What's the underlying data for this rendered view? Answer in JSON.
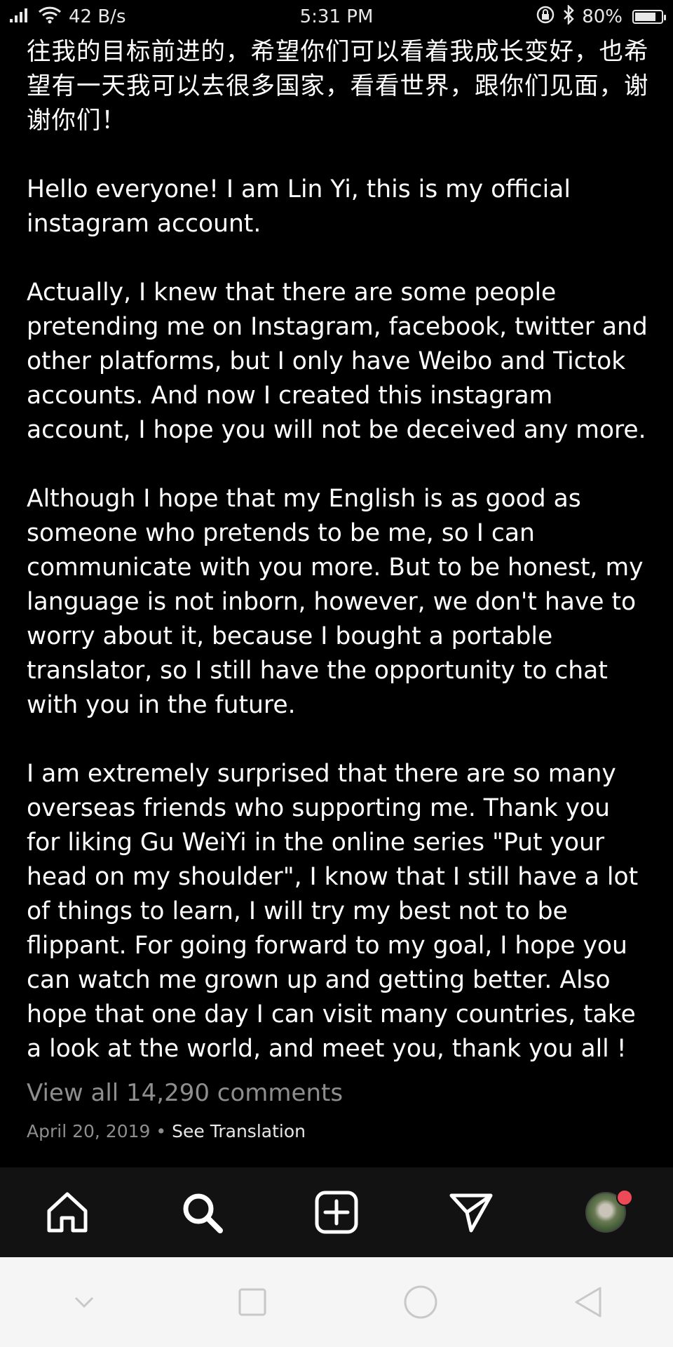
{
  "status_bar": {
    "net_speed": "42 B/s",
    "time": "5:31 PM",
    "battery_percent": "80%",
    "battery_level": 0.8,
    "icons": [
      "signal-icon",
      "wifi-icon",
      "rotation-lock-icon",
      "bluetooth-icon",
      "battery-icon"
    ]
  },
  "post": {
    "caption_paragraphs": [
      "往我的目标前进的，希望你们可以看着我成长变好，也希望有一天我可以去很多国家，看看世界，跟你们见面，谢谢你们！",
      "Hello everyone! I am Lin Yi, this is my official instagram account.",
      "Actually, I knew that there are some people pretending me on Instagram, facebook, twitter and other platforms, but I only have Weibo and Tictok accounts.  And now I created this instagram account, I hope you will not be deceived any more.",
      "Although I hope that my English is as good as someone who pretends to be me, so I can communicate with you more. But to be honest, my language is not inborn, however, we don't have to worry about it, because I bought a portable translator, so I still have the opportunity to chat with you in the future.",
      "I am extremely surprised that there are so many overseas friends who supporting me. Thank you for liking Gu WeiYi in the online series \"Put your head on my shoulder\", I know that I still have a lot of things to learn, I will try my best not to be flippant. For going forward to my goal, I hope you can watch me grown up and getting better. Also hope that one day I can visit many countries, take a look at the world, and meet you, thank you all !"
    ],
    "view_comments": "View all 14,290 comments",
    "date": "April 20, 2019",
    "separator": "•",
    "see_translation": "See Translation"
  },
  "bottom_nav": {
    "items": [
      "home-icon",
      "search-icon",
      "new-post-icon",
      "direct-message-icon",
      "profile-avatar"
    ],
    "has_notification": true
  },
  "system_nav": {
    "items": [
      "collapse-icon",
      "recents-icon",
      "home-circle-icon",
      "back-icon"
    ]
  },
  "colors": {
    "background": "#000000",
    "text": "#ffffff",
    "muted": "#8e8e8e",
    "nav_bar": "#121212",
    "notification": "#ed4956",
    "system_nav": "#f5f5f5"
  }
}
